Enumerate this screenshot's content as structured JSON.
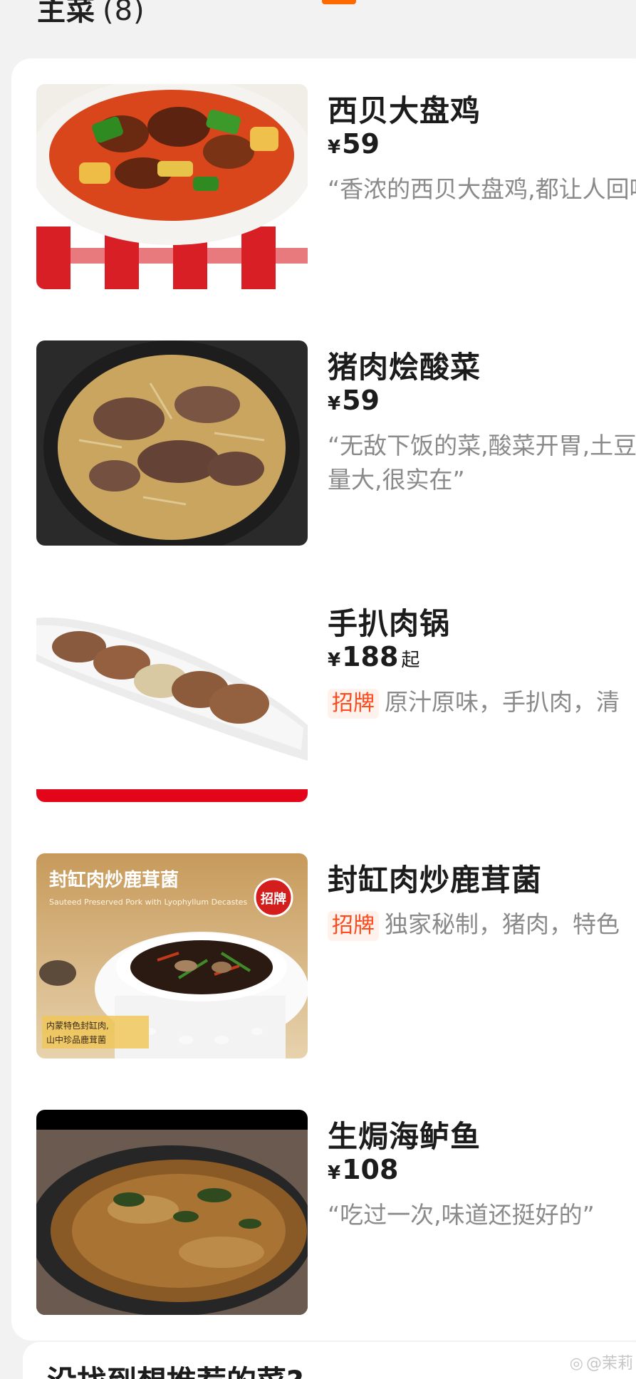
{
  "section": {
    "title": "主菜",
    "count": "(8)"
  },
  "items": [
    {
      "name": "西贝大盘鸡",
      "price_symbol": "¥",
      "price": "59",
      "desc": "“香浓的西贝大盘鸡,都让人回味"
    },
    {
      "name": "猪肉烩酸菜",
      "price_symbol": "¥",
      "price": "59",
      "desc": "“无敌下饭的菜,酸菜开胃,土豆量大,很实在”"
    },
    {
      "name": "手扒肉锅",
      "price_symbol": "¥",
      "price": "188",
      "price_suffix": "起",
      "badge": "招牌",
      "desc": "原汁原味，手扒肉，清"
    },
    {
      "name": "封缸肉炒鹿茸菌",
      "badge": "招牌",
      "desc": "独家秘制，猪肉，特色",
      "image_text": {
        "title": "封缸肉炒鹿茸菌",
        "subtitle_en": "Sauteed Preserved Pork with Lyophyllum Decastes",
        "caption_line1": "内蒙特色封缸肉,",
        "caption_line2": "山中珍品鹿茸菌",
        "seal": "招牌"
      }
    },
    {
      "name": "生焗海鲈鱼",
      "price_symbol": "¥",
      "price": "108",
      "desc": "“吃过一次,味道还挺好的”"
    }
  ],
  "bottom": {
    "title": "没找到想推荐的菜?"
  },
  "watermark": {
    "text": "@茉莉"
  },
  "colors": {
    "accent": "#ff6a00",
    "badge_text": "#ff4a1c",
    "badge_bg": "#fff1ec"
  }
}
